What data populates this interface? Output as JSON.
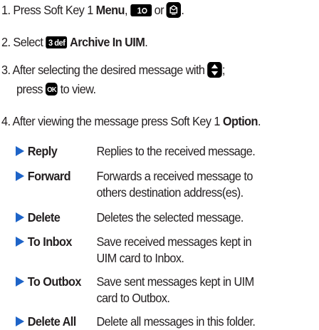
{
  "steps": {
    "s1": {
      "num": "1.",
      "pre": "Press Soft Key 1 ",
      "bold": "Menu",
      "comma": ",",
      "key1": "1",
      "or": "or",
      "end": "."
    },
    "s2": {
      "num": "2.",
      "pre": "Select",
      "key3": "3 def",
      "bold": "Archive In UIM",
      "end": "."
    },
    "s3": {
      "num": "3.",
      "line1": "After selecting the desired message with",
      "semi": ";",
      "press": "press",
      "ok": "OK",
      "line2end": "to view."
    },
    "s4": {
      "num": "4.",
      "pre": "After viewing the message press Soft Key 1 ",
      "bold": "Option",
      "end": "."
    }
  },
  "options": [
    {
      "name": "Reply",
      "desc": "Replies to the received message."
    },
    {
      "name": "Forward",
      "desc": "Forwards a received message to others destination address(es)."
    },
    {
      "name": "Delete",
      "desc": "Deletes the selected message."
    },
    {
      "name": "To Inbox",
      "desc": "Save received messages kept in UIM card to Inbox."
    },
    {
      "name": "To Outbox",
      "desc": "Save sent messages kept in UIM card to Outbox."
    },
    {
      "name": "Delete All",
      "desc": "Delete all messages in this folder."
    }
  ],
  "icons": {
    "key1": "numeric-key-1-icon",
    "message": "message-key-icon",
    "key3": "numeric-key-3-icon",
    "nav": "navigation-key-icon",
    "ok": "ok-key-icon",
    "bullet": "triangle-bullet-icon"
  },
  "colors": {
    "bullet": "#1e64c8",
    "text": "#231f20",
    "key": "#000000"
  }
}
